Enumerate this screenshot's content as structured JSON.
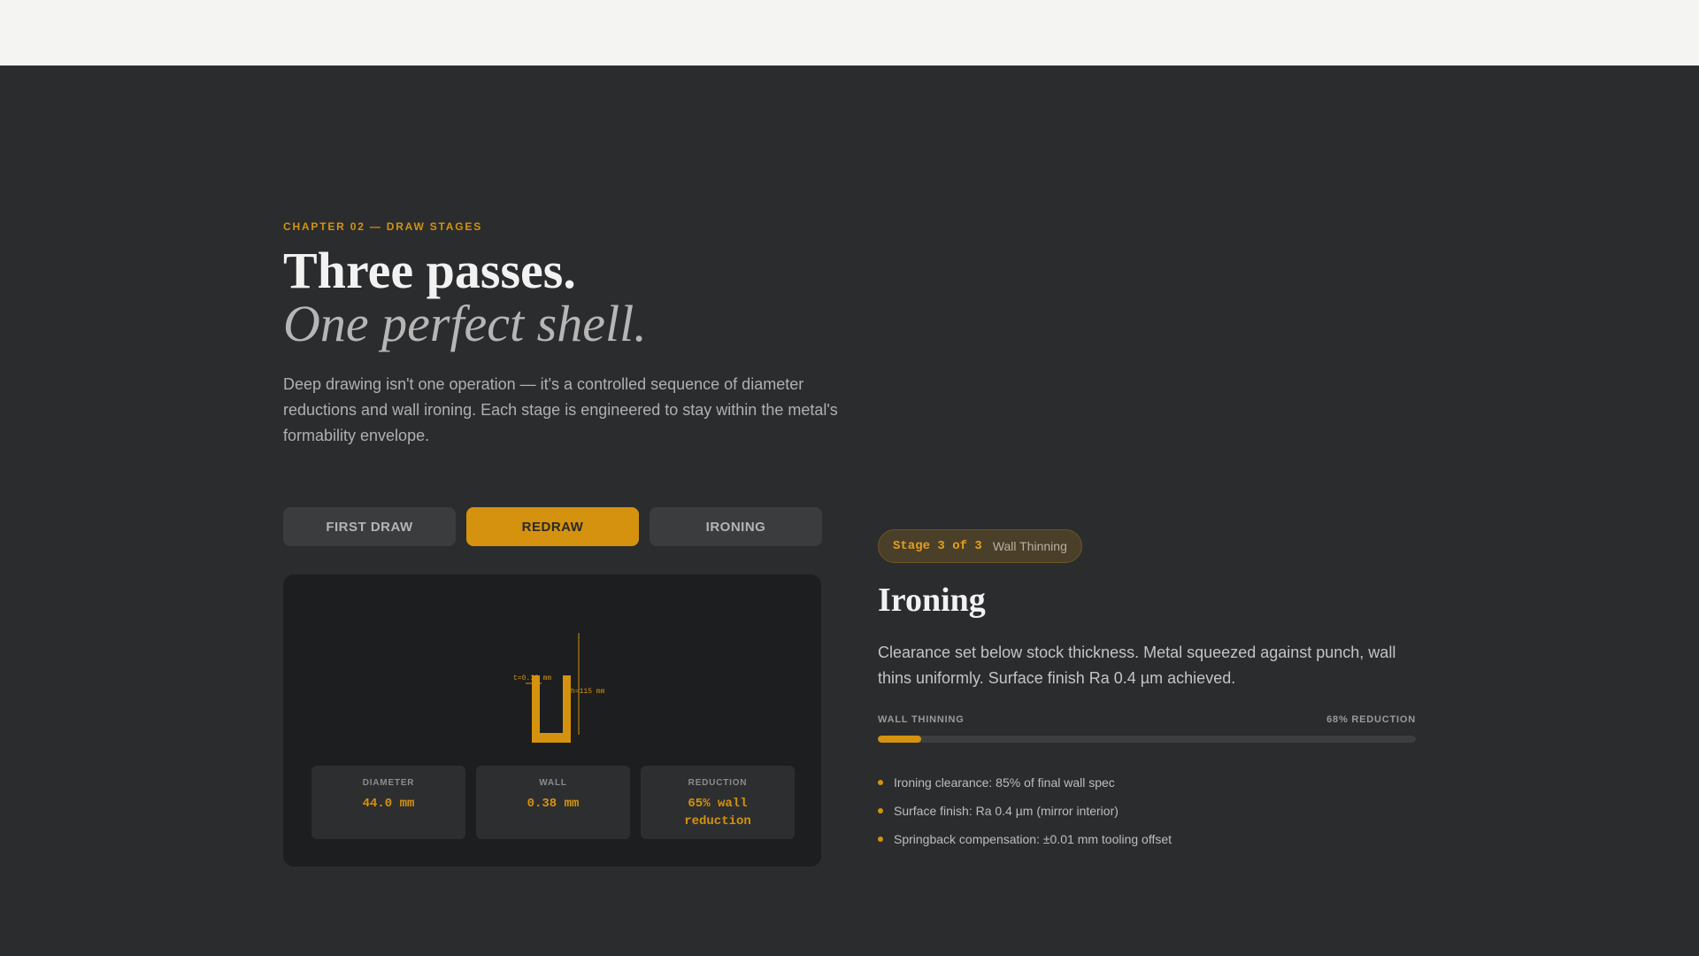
{
  "eyebrow": "CHAPTER 02 — DRAW STAGES",
  "title_line1": "Three passes.",
  "title_line2": "One perfect shell.",
  "intro": "Deep drawing isn't one operation — it's a controlled sequence of diameter reductions and wall ironing. Each stage is engineered to stay within the metal's formability envelope.",
  "tabs": [
    {
      "label": "FIRST DRAW",
      "active": false
    },
    {
      "label": "REDRAW",
      "active": true
    },
    {
      "label": "IRONING",
      "active": false
    }
  ],
  "diagram": {
    "thickness_label": "t=0.38 mm",
    "height_label": "h=115 mm"
  },
  "stats": [
    {
      "label": "DIAMETER",
      "value": "44.0 mm"
    },
    {
      "label": "WALL",
      "value": "0.38 mm"
    },
    {
      "label": "REDUCTION",
      "value": "65% wall reduction"
    }
  ],
  "badge": {
    "stage": "Stage 3 of 3",
    "name": "Wall Thinning"
  },
  "stage": {
    "title": "Ironing",
    "description": "Clearance set below stock thickness. Metal squeezed against punch, wall thins uniformly. Surface finish Ra 0.4 µm achieved."
  },
  "meter": {
    "label": "WALL THINNING",
    "value_text": "68% REDUCTION",
    "fill_fraction": 0.08
  },
  "bullets": [
    "Ironing clearance: 85% of final wall spec",
    "Surface finish: Ra 0.4 µm (mirror interior)",
    "Springback compensation: ±0.01 mm tooling offset"
  ],
  "colors": {
    "accent": "#d4920f",
    "background": "#2b2c2e",
    "panel": "#1d1e1f"
  }
}
